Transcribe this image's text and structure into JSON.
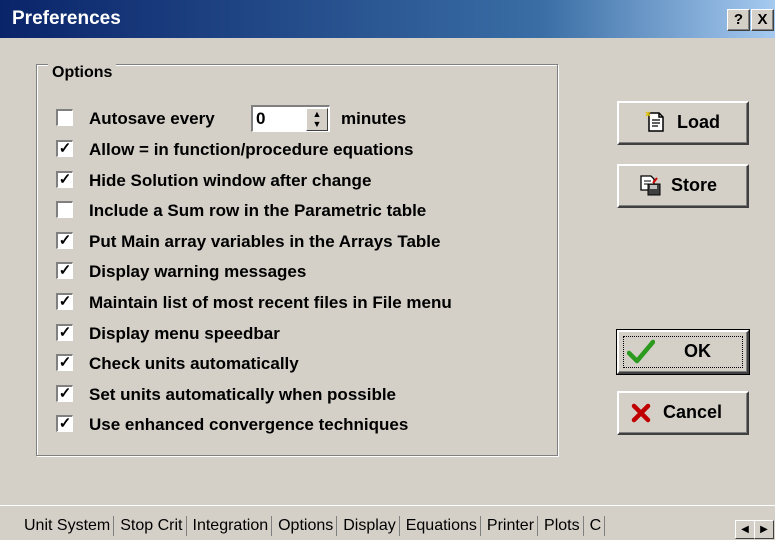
{
  "window": {
    "title": "Preferences",
    "help_label": "?",
    "close_label": "X"
  },
  "options": {
    "group_label": "Options",
    "autosave": {
      "checked": false,
      "prefix": "Autosave every",
      "value": "0",
      "suffix": "minutes"
    },
    "items": [
      {
        "label": "Allow = in function/procedure equations",
        "checked": true
      },
      {
        "label": "Hide Solution window after change",
        "checked": true
      },
      {
        "label": "Include a Sum row in the Parametric table",
        "checked": false
      },
      {
        "label": "Put Main array variables in the Arrays Table",
        "checked": true
      },
      {
        "label": "Display warning messages",
        "checked": true
      },
      {
        "label": "Maintain list of most recent files in File menu",
        "checked": true
      },
      {
        "label": "Display menu speedbar",
        "checked": true
      },
      {
        "label": "Check units automatically",
        "checked": true
      },
      {
        "label": "Set units automatically when possible",
        "checked": true
      },
      {
        "label": "Use enhanced convergence techniques",
        "checked": true
      }
    ]
  },
  "buttons": {
    "load": "Load",
    "store": "Store",
    "ok": "OK",
    "cancel": "Cancel"
  },
  "icons": {
    "load": "document-load-icon",
    "store": "floppy-store-icon",
    "ok": "green-checkmark-icon",
    "cancel": "red-x-icon"
  },
  "colors": {
    "title_start": "#0a246a",
    "title_end": "#a6caf0",
    "ok_check": "#2c9a1e",
    "cancel_x": "#c00000"
  },
  "tabs": {
    "items": [
      "Unit System",
      "Stop Crit",
      "Integration",
      "Options",
      "Display",
      "Equations",
      "Printer",
      "Plots",
      "C"
    ],
    "active": "Options"
  }
}
